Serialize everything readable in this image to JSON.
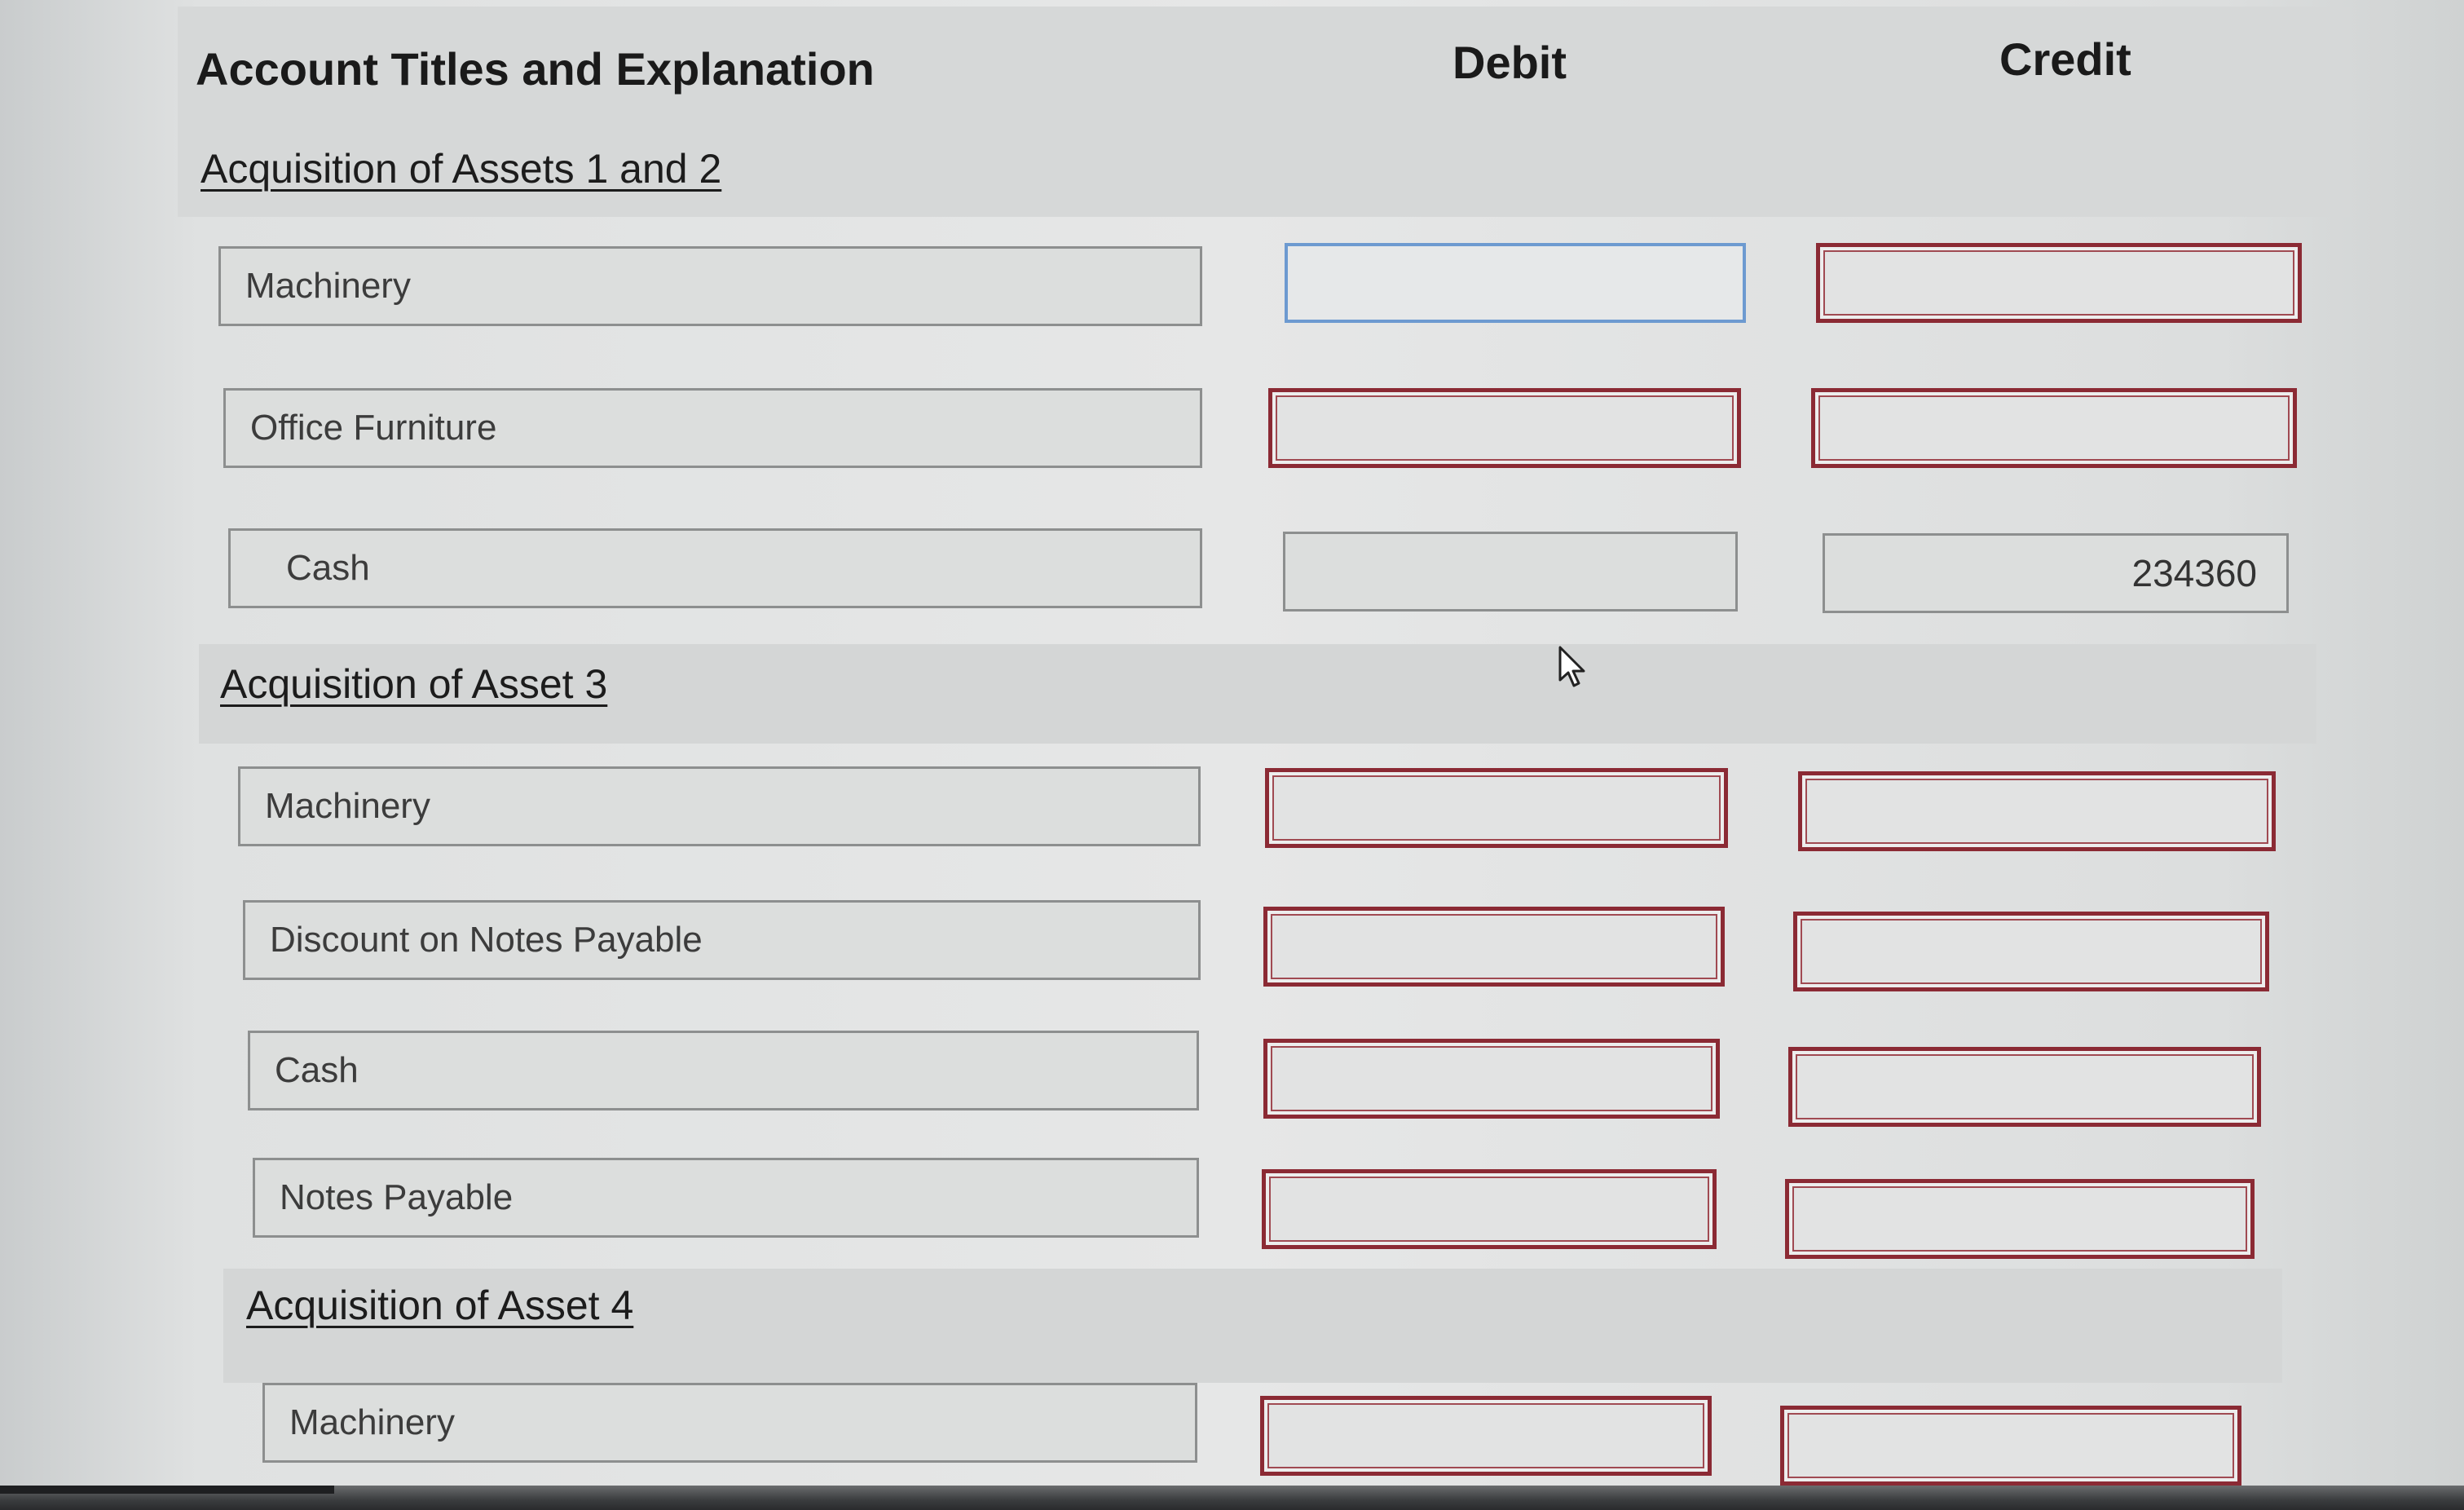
{
  "columns": {
    "account": "Account Titles and Explanation",
    "debit": "Debit",
    "credit": "Credit"
  },
  "sections": [
    {
      "title": "Acquisition of Assets 1 and 2",
      "rows": [
        {
          "account": "Machinery",
          "debit": "",
          "credit": ""
        },
        {
          "account": "Office Furniture",
          "debit": "",
          "credit": ""
        },
        {
          "account": "Cash",
          "debit": "",
          "credit": "234360"
        }
      ]
    },
    {
      "title": "Acquisition of Asset 3",
      "rows": [
        {
          "account": "Machinery",
          "debit": "",
          "credit": ""
        },
        {
          "account": "Discount on Notes Payable",
          "debit": "",
          "credit": ""
        },
        {
          "account": "Cash",
          "debit": "",
          "credit": ""
        },
        {
          "account": "Notes Payable",
          "debit": "",
          "credit": ""
        }
      ]
    },
    {
      "title": "Acquisition of Asset 4",
      "rows": [
        {
          "account": "Machinery",
          "debit": "",
          "credit": ""
        }
      ]
    }
  ],
  "colors": {
    "error_border": "#8b2a34",
    "focus_border": "#6d9ad0",
    "band": "#d4d6d6"
  }
}
